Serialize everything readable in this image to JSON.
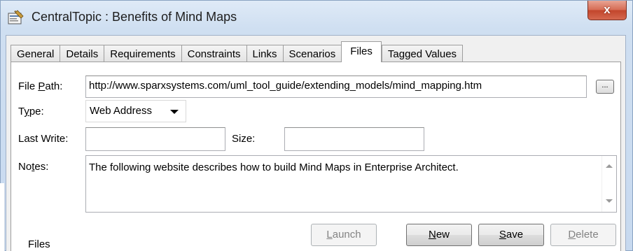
{
  "window": {
    "title": "CentralTopic : Benefits of Mind Maps",
    "close_glyph": "x",
    "icon": "properties-window-icon"
  },
  "tabs": [
    {
      "label": "General",
      "active": false
    },
    {
      "label": "Details",
      "active": false
    },
    {
      "label": "Requirements",
      "active": false
    },
    {
      "label": "Constraints",
      "active": false
    },
    {
      "label": "Links",
      "active": false
    },
    {
      "label": "Scenarios",
      "active": false
    },
    {
      "label": "Files",
      "active": true
    },
    {
      "label": "Tagged Values",
      "active": false
    }
  ],
  "form": {
    "file_path": {
      "label_pre": "File ",
      "label_key": "P",
      "label_post": "ath:",
      "value": "http://www.sparxsystems.com/uml_tool_guide/extending_models/mind_mapping.htm",
      "browse_label": "..."
    },
    "type": {
      "label_pre": "T",
      "label_key": "y",
      "label_post": "pe:",
      "value": "Web Address"
    },
    "last_write": {
      "label": "Last Write:",
      "value": ""
    },
    "size": {
      "label": "Size:",
      "value": ""
    },
    "notes": {
      "label_pre": "No",
      "label_key": "t",
      "label_post": "es:",
      "value": "The following website describes how to build Mind Maps in Enterprise Architect."
    }
  },
  "files_label": "Files",
  "buttons": {
    "launch": {
      "pre": "",
      "key": "L",
      "post": "aunch",
      "enabled": false
    },
    "new": {
      "pre": "",
      "key": "N",
      "post": "ew",
      "enabled": true
    },
    "save": {
      "pre": "",
      "key": "S",
      "post": "ave",
      "enabled": true
    },
    "delete": {
      "pre": "",
      "key": "D",
      "post": "elete",
      "enabled": false
    }
  }
}
